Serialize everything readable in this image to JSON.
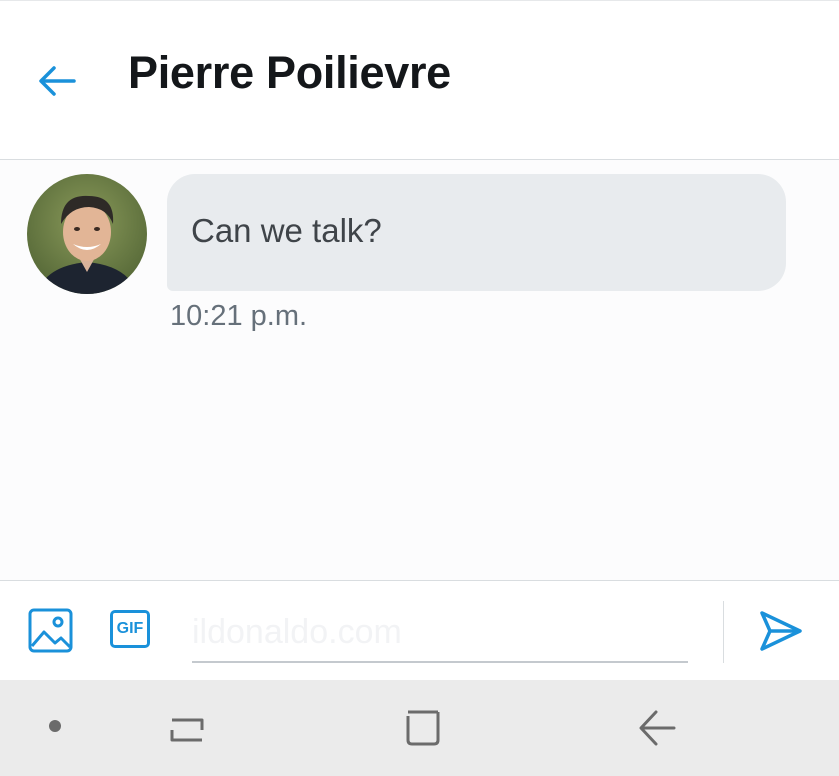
{
  "header": {
    "title": "Pierre Poilievre",
    "back_icon": "arrow-left-icon"
  },
  "conversation": {
    "messages": [
      {
        "sender_avatar": "avatar",
        "text": "Can we talk?",
        "time": "10:21 p.m."
      }
    ]
  },
  "composer": {
    "image_icon": "image-icon",
    "gif_label": "GIF",
    "input_value": "",
    "input_placeholder": "ildonaldo.com",
    "send_icon": "send-icon"
  },
  "system_nav": {
    "icons": [
      "dot-icon",
      "recents-icon",
      "home-icon",
      "back-icon"
    ]
  },
  "colors": {
    "accent": "#1a91da",
    "bubble": "#e8ebee",
    "title_text": "#14171a",
    "timestamp_text": "#66707a",
    "navbar": "#ebebeb"
  }
}
